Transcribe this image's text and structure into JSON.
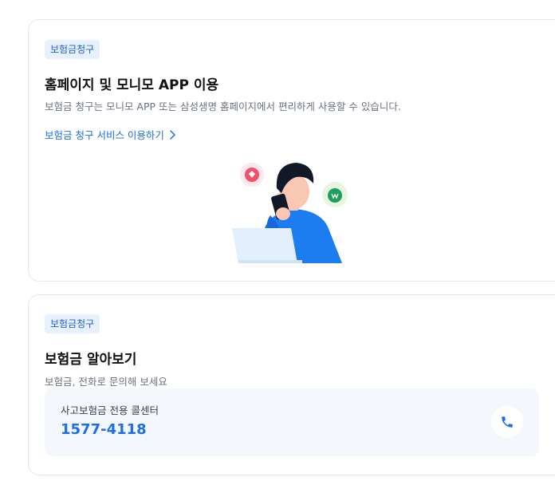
{
  "card1": {
    "badge": "보험금청구",
    "title": "홈페이지 및 모니모 APP 이용",
    "description": "보험금 청구는 모니모 APP 또는 삼성생명 홈페이지에서 편리하게 사용할 수 있습니다.",
    "link_label": "보험금 청구 서비스 이용하기",
    "link_icon": "chevron-right-icon",
    "illustration": "person-with-phone-illustration"
  },
  "card2": {
    "badge": "보험금청구",
    "title": "보험금 알아보기",
    "description": "보험금, 전화로 문의해 보세요",
    "call_center": {
      "label": "사고보험금 전용 콜센터",
      "number": "1577-4118",
      "icon": "phone-icon"
    }
  },
  "colors": {
    "accent": "#1d6fe5",
    "badge_bg": "#e8f2ff",
    "callbox_bg": "#f4f7fb"
  }
}
